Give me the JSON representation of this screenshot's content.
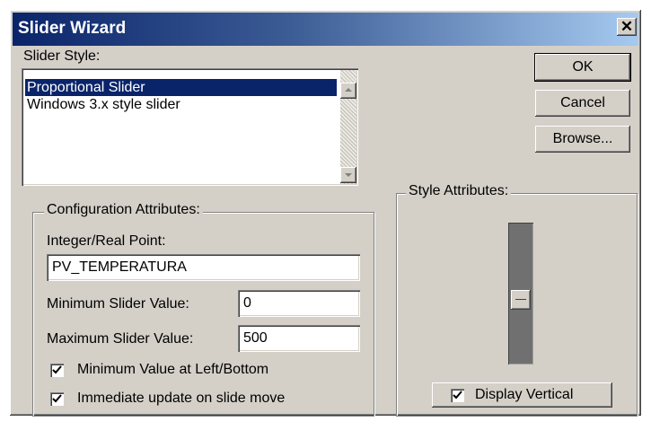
{
  "window": {
    "title": "Slider Wizard",
    "close_glyph": "✕"
  },
  "slider_style": {
    "label": "Slider Style:",
    "items": [
      "Proportional Slider",
      "Windows 3.x style slider"
    ],
    "selected_index": 0
  },
  "buttons": {
    "ok": "OK",
    "cancel": "Cancel",
    "browse": "Browse..."
  },
  "config": {
    "group_label": "Configuration Attributes:",
    "point_label": "Integer/Real Point:",
    "point_value": "PV_TEMPERATURA",
    "min_label": "Minimum Slider Value:",
    "min_value": "0",
    "max_label": "Maximum Slider Value:",
    "max_value": "500",
    "check_min_left": {
      "label": "Minimum Value at Left/Bottom",
      "checked": true
    },
    "check_immediate": {
      "label": "Immediate update on slide move",
      "checked": true
    }
  },
  "style_attrs": {
    "group_label": "Style Attributes:",
    "slider_level": 0.45,
    "display_vertical": {
      "label": "Display Vertical",
      "checked": true
    }
  },
  "icons": [
    "close-icon",
    "scroll-up-arrow-icon",
    "scroll-down-arrow-icon",
    "checkmark-icon"
  ]
}
